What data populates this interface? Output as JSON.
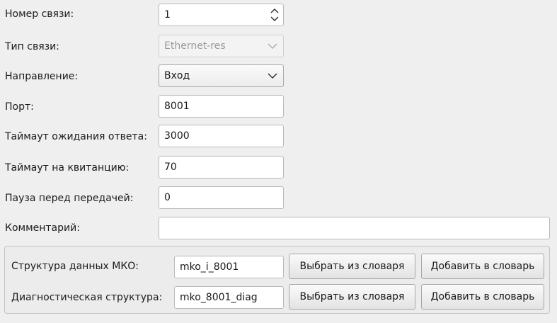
{
  "fields": {
    "link_number": {
      "label": "Номер связи:",
      "value": "1"
    },
    "link_type": {
      "label": "Тип связи:",
      "value": "Ethernet-res"
    },
    "direction": {
      "label": "Направление:",
      "value": "Вход"
    },
    "port": {
      "label": "Порт:",
      "value": "8001"
    },
    "response_timeout": {
      "label": "Таймаут ожидания ответа:",
      "value": "3000"
    },
    "ack_timeout": {
      "label": "Таймаут на квитанцию:",
      "value": "70"
    },
    "pause_before_send": {
      "label": "Пауза перед передачей:",
      "value": "0"
    },
    "comment": {
      "label": "Комментарий:",
      "value": ""
    }
  },
  "mko_group": {
    "data_structure": {
      "label": "Структура данных МКО:",
      "value": "mko_i_8001",
      "select_button": "Выбрать из словаря",
      "add_button": "Добавить в словарь"
    },
    "diag_structure": {
      "label": "Диагностическая структура:",
      "value": "mko_8001_diag",
      "select_button": "Выбрать из словаря",
      "add_button": "Добавить в словарь"
    }
  },
  "icons": {
    "spin": "up-down-spinner-icon",
    "dropdown": "chevron-down-icon"
  }
}
